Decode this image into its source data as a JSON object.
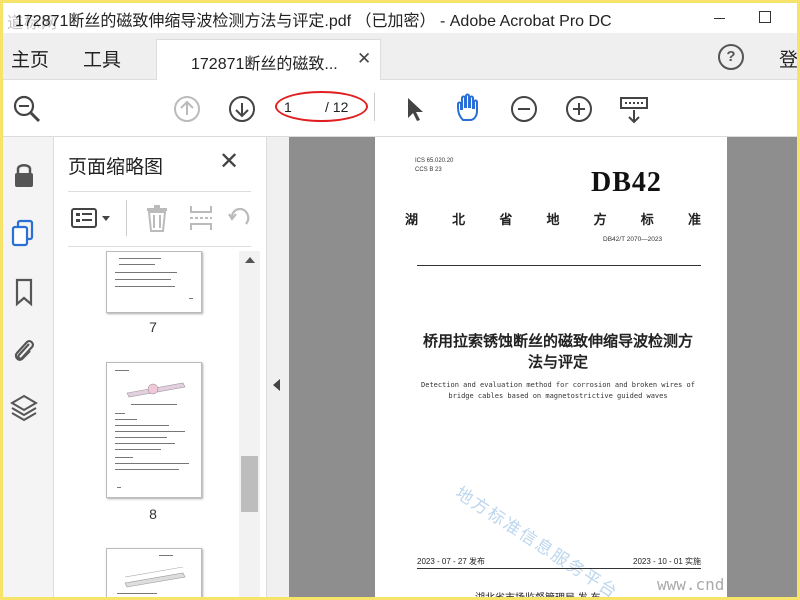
{
  "window": {
    "title": "172871断丝的磁致伸缩导波检测方法与评定.pdf （已加密） - Adobe Acrobat Pro DC",
    "watermark_logo": "道标网"
  },
  "menu": {
    "home": "主页",
    "tools": "工具",
    "sign_in": "登"
  },
  "tab": {
    "label": "172871断丝的磁致...",
    "close": "✕"
  },
  "help": "?",
  "toolbar": {
    "page_current": "1",
    "page_total": "/ 12"
  },
  "thumbnails": {
    "title": "页面缩略图",
    "close": "✕",
    "pages": [
      "7",
      "8"
    ]
  },
  "document": {
    "ics": "ICS  65.020.20",
    "ccs": "CCS  B 23",
    "db": "DB42",
    "standard_chars": [
      "湖",
      "北",
      "省",
      "地",
      "方",
      "标",
      "准"
    ],
    "number": "DB42/T 2070—2023",
    "title_line1": "桥用拉索锈蚀断丝的磁致伸缩导波检测方",
    "title_line2": "法与评定",
    "english_line1": "Detection and evaluation method for corrosion and broken wires of",
    "english_line2": "bridge cables based on magnetostrictive guided waves",
    "watermark": "地方标准信息服务平台",
    "release_date": "2023 - 07 - 27 发布",
    "impl_date": "2023 - 10 - 01 实施",
    "issuer": "湖北省市场监督管理局    发 布"
  },
  "overlay_url": "www.cnd"
}
